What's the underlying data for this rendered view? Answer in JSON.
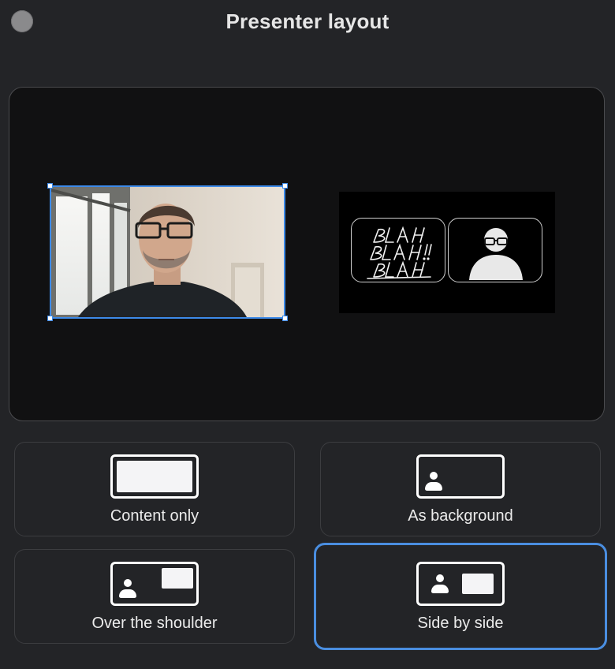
{
  "window": {
    "title": "Presenter layout"
  },
  "preview": {
    "camera_selected": true,
    "content_image_text": "BLAH BLAH!! BLAH"
  },
  "layouts": [
    {
      "label": "Content only",
      "icon": "content-only-icon",
      "selected": false
    },
    {
      "label": "As background",
      "icon": "as-background-icon",
      "selected": false
    },
    {
      "label": "Over the shoulder",
      "icon": "over-the-shoulder-icon",
      "selected": false
    },
    {
      "label": "Side by side",
      "icon": "side-by-side-icon",
      "selected": true
    }
  ],
  "colors": {
    "window_bg": "#232427",
    "preview_bg": "#111112",
    "accent": "#4a8ee0",
    "selection_border": "#3d8ae8",
    "text": "#ececec"
  }
}
